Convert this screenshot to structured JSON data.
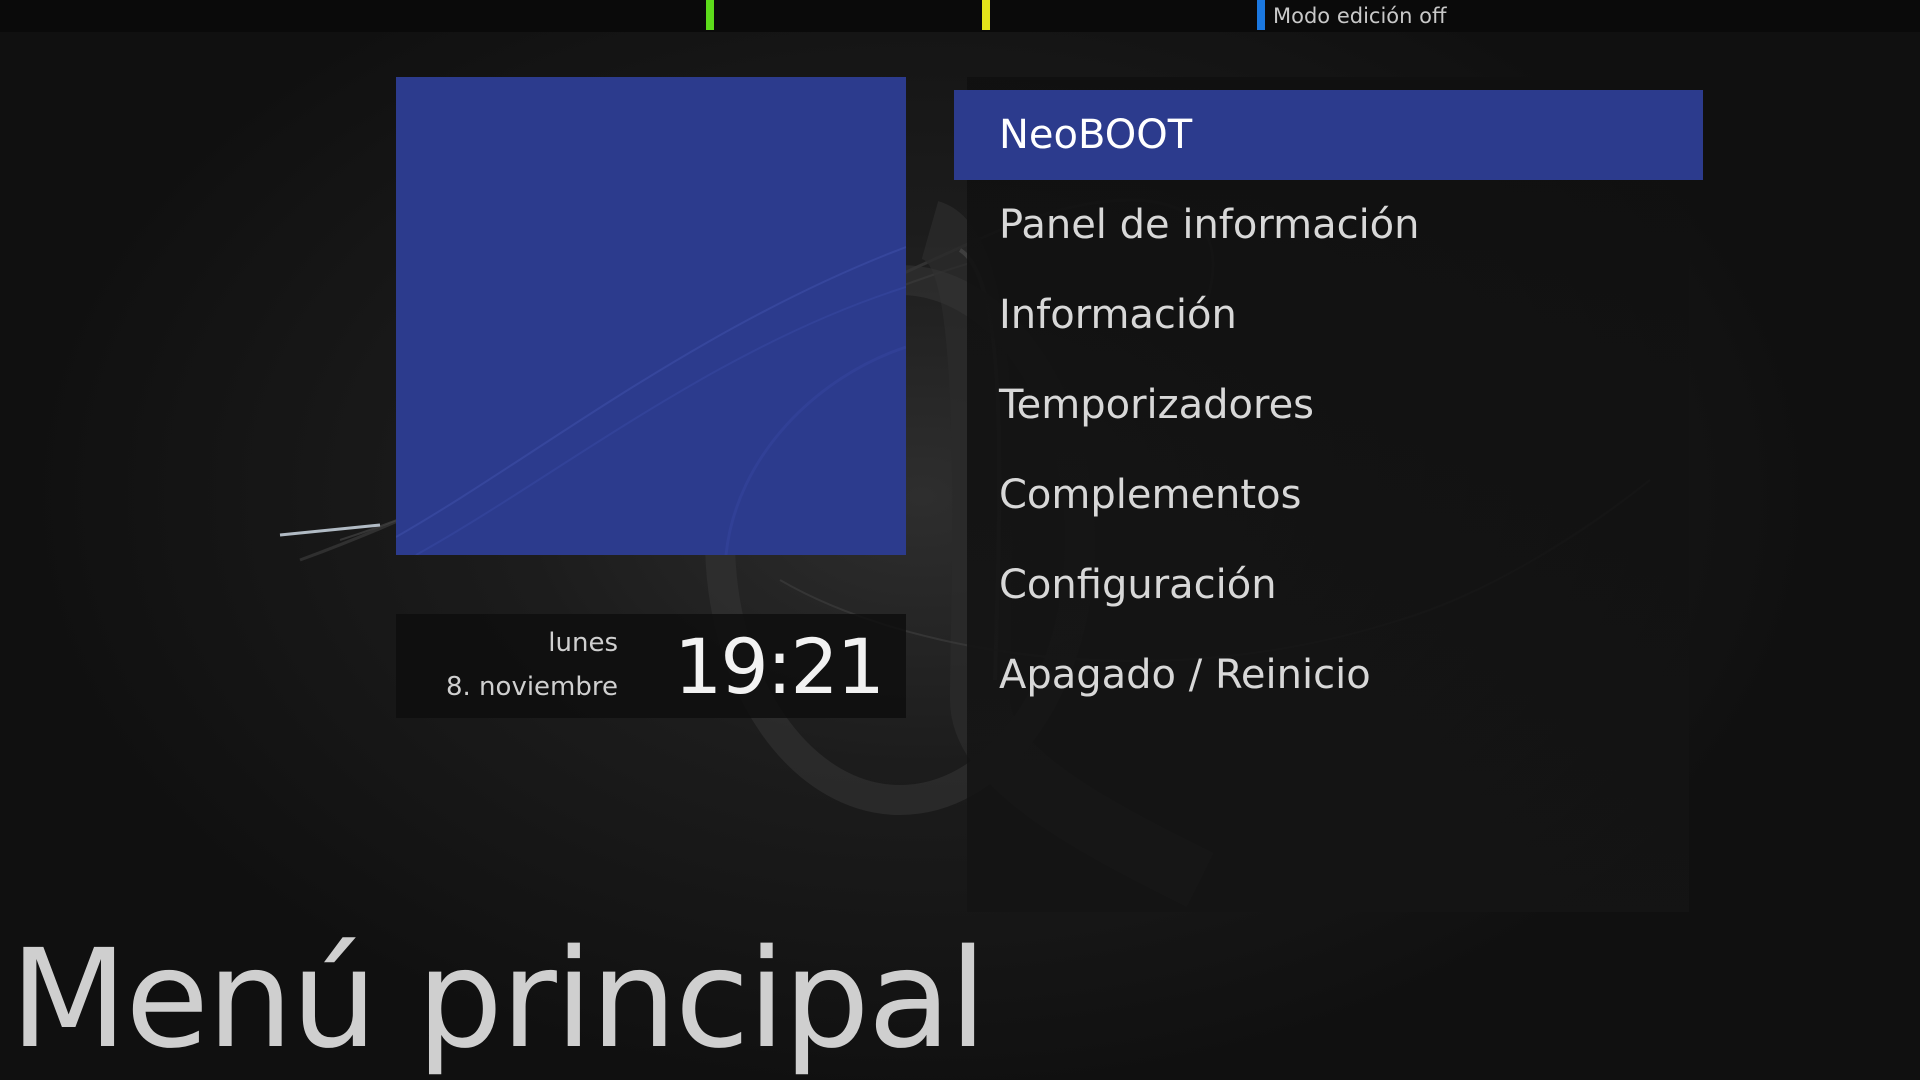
{
  "top_bar": {
    "color_keys": [
      {
        "name": "green",
        "color": "#5ddc1b"
      },
      {
        "name": "yellow",
        "color": "#e5e51a"
      },
      {
        "name": "blue",
        "color": "#1b78e0"
      }
    ],
    "edit_mode_label": "Modo edición off"
  },
  "preview": {
    "color": "#2c3b8d"
  },
  "clock": {
    "day": "lunes",
    "date": "8. noviembre",
    "time": "19:21"
  },
  "menu": {
    "selected_color": "#2c3b8d",
    "items": [
      {
        "label": "NeoBOOT",
        "selected": true
      },
      {
        "label": "Panel de información",
        "selected": false
      },
      {
        "label": "Información",
        "selected": false
      },
      {
        "label": "Temporizadores",
        "selected": false
      },
      {
        "label": "Complementos",
        "selected": false
      },
      {
        "label": "Configuración",
        "selected": false
      },
      {
        "label": "Apagado / Reinicio",
        "selected": false
      }
    ]
  },
  "title": "Menú principal"
}
